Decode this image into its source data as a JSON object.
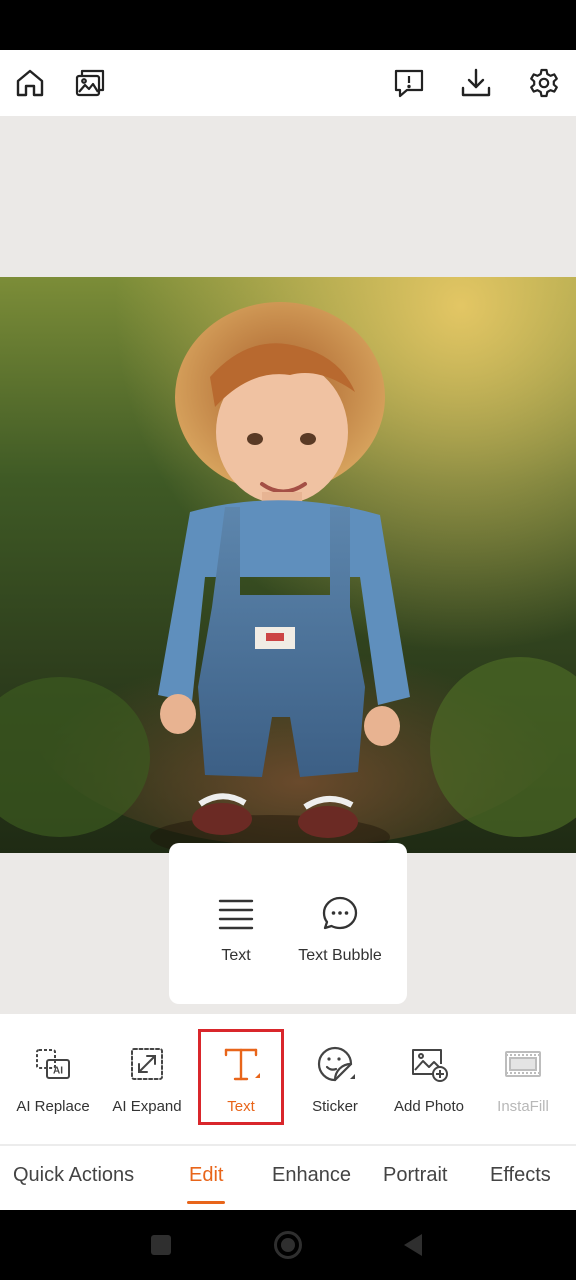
{
  "top_bar": {
    "icons": [
      "home-icon",
      "gallery-icon",
      "feedback-icon",
      "download-icon",
      "settings-icon"
    ]
  },
  "text_popup": {
    "items": [
      {
        "label": "Text",
        "icon": "lines-icon"
      },
      {
        "label": "Text Bubble",
        "icon": "chat-bubble-icon"
      }
    ]
  },
  "tools": {
    "items": [
      {
        "label": "AI Replace",
        "icon": "ai-replace-icon",
        "state": "normal"
      },
      {
        "label": "AI Expand",
        "icon": "ai-expand-icon",
        "state": "normal"
      },
      {
        "label": "Text",
        "icon": "text-t-icon",
        "state": "active"
      },
      {
        "label": "Sticker",
        "icon": "sticker-icon",
        "state": "normal"
      },
      {
        "label": "Add Photo",
        "icon": "add-photo-icon",
        "state": "normal"
      },
      {
        "label": "InstaFill",
        "icon": "instafill-icon",
        "state": "disabled"
      }
    ]
  },
  "tabs": {
    "items": [
      "Quick Actions",
      "Edit",
      "Enhance",
      "Portrait",
      "Effects"
    ],
    "active": "Edit"
  },
  "colors": {
    "accent": "#e8651a",
    "highlight": "#d9262b",
    "background": "#ebe9e7"
  },
  "system_nav": {
    "icons": [
      "recents-square-icon",
      "home-circle-icon",
      "back-triangle-icon"
    ]
  }
}
